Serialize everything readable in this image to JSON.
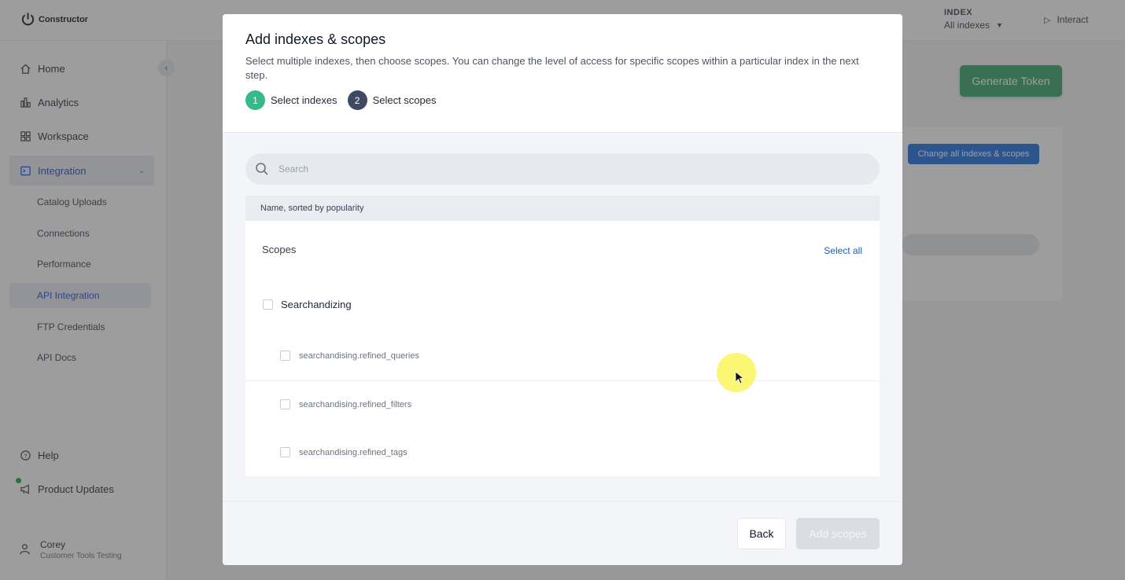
{
  "app": {
    "logo_text": "Constructor",
    "index": {
      "label": "INDEX",
      "value": "All indexes"
    },
    "interact_label": "Interact"
  },
  "sidebar": {
    "items": [
      {
        "label": "Home",
        "icon": "home-icon"
      },
      {
        "label": "Analytics",
        "icon": "analytics-icon"
      },
      {
        "label": "Workspace",
        "icon": "workspace-icon"
      },
      {
        "label": "Integration",
        "icon": "integration-icon"
      }
    ],
    "sub_items": [
      {
        "label": "Catalog Uploads"
      },
      {
        "label": "Connections"
      },
      {
        "label": "Performance"
      },
      {
        "label": "API Integration"
      },
      {
        "label": "FTP Credentials"
      },
      {
        "label": "API Docs"
      }
    ],
    "bottom": [
      {
        "label": "Help",
        "icon": "help-icon"
      },
      {
        "label": "Product Updates",
        "icon": "megaphone-icon"
      }
    ],
    "user": {
      "name": "Corey",
      "org": "Customer Tools Testing"
    }
  },
  "page": {
    "generate_token_label": "Generate Token",
    "change_all_label": "Change all indexes & scopes"
  },
  "modal": {
    "title": "Add indexes & scopes",
    "description": "Select multiple indexes, then choose scopes. You can change the level of access for specific scopes within a particular index in the next step.",
    "steps": [
      {
        "num": "1",
        "label": "Select indexes"
      },
      {
        "num": "2",
        "label": "Select scopes"
      }
    ],
    "search_placeholder": "Search",
    "list_header": "Name, sorted by popularity",
    "scopes_title": "Scopes",
    "select_all_label": "Select all",
    "group": {
      "label": "Searchandizing"
    },
    "scopes": [
      {
        "label": "searchandising.refined_queries"
      },
      {
        "label": "searchandising.refined_filters"
      },
      {
        "label": "searchandising.refined_tags"
      }
    ],
    "back_label": "Back",
    "add_label": "Add scopes"
  },
  "colors": {
    "accent_green": "#37a56a",
    "step_done": "#37b98a",
    "step_current": "#3f4a62",
    "link_blue": "#1d5fbf"
  }
}
